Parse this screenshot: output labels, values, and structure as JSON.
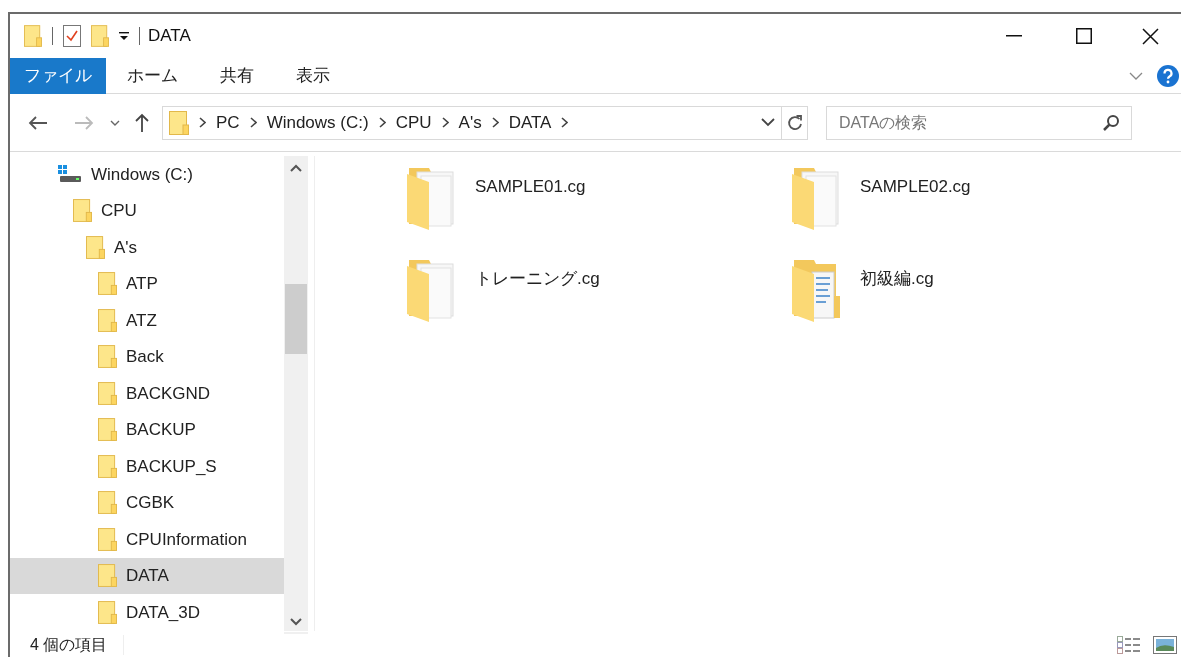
{
  "window": {
    "title": "DATA"
  },
  "ribbon_tabs": [
    {
      "label": "ファイル",
      "kind": "file-menu"
    },
    {
      "label": "ホーム",
      "kind": "tab"
    },
    {
      "label": "共有",
      "kind": "tab"
    },
    {
      "label": "表示",
      "kind": "tab"
    }
  ],
  "address_bar": {
    "crumbs": [
      "PC",
      "Windows (C:)",
      "CPU",
      "A's",
      "DATA"
    ]
  },
  "search": {
    "placeholder": "DATAの検索"
  },
  "navigation_tree": [
    {
      "label": "Windows (C:)",
      "kind": "drive",
      "selected": false,
      "children": [
        {
          "label": "CPU",
          "kind": "folder",
          "selected": false,
          "children": [
            {
              "label": "A's",
              "kind": "folder",
              "selected": false,
              "children": [
                {
                  "label": "ATP",
                  "kind": "folder",
                  "selected": false
                },
                {
                  "label": "ATZ",
                  "kind": "folder",
                  "selected": false
                },
                {
                  "label": "Back",
                  "kind": "folder",
                  "selected": false
                },
                {
                  "label": "BACKGND",
                  "kind": "folder",
                  "selected": false
                },
                {
                  "label": "BACKUP",
                  "kind": "folder",
                  "selected": false
                },
                {
                  "label": "BACKUP_S",
                  "kind": "folder",
                  "selected": false
                },
                {
                  "label": "CGBK",
                  "kind": "folder",
                  "selected": false
                },
                {
                  "label": "CPUInformation",
                  "kind": "folder",
                  "selected": false
                },
                {
                  "label": "DATA",
                  "kind": "folder",
                  "selected": true
                },
                {
                  "label": "DATA_3D",
                  "kind": "folder",
                  "selected": false
                }
              ]
            }
          ]
        }
      ]
    }
  ],
  "files": [
    {
      "name": "SAMPLE01.cg",
      "kind": "pages"
    },
    {
      "name": "SAMPLE02.cg",
      "kind": "pages"
    },
    {
      "name": "トレーニング.cg",
      "kind": "pages"
    },
    {
      "name": "初級編.cg",
      "kind": "document"
    }
  ],
  "status_bar": {
    "item_count": "4 個の項目"
  }
}
